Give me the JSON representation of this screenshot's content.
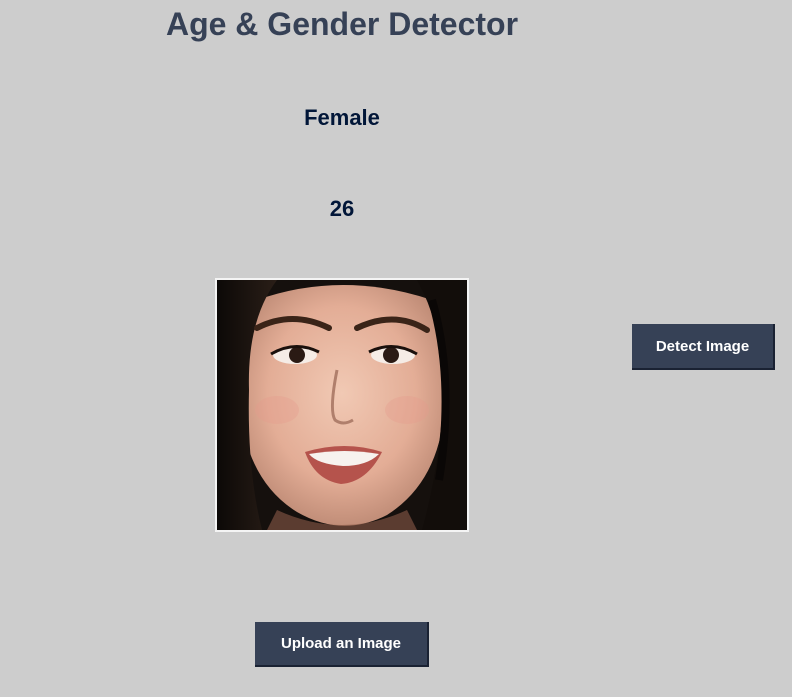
{
  "app": {
    "title": "Age & Gender Detector"
  },
  "result": {
    "gender": "Female",
    "age": "26"
  },
  "image": {
    "description_icon": "face-photo"
  },
  "buttons": {
    "detect_label": "Detect Image",
    "upload_label": "Upload an Image"
  },
  "colors": {
    "background": "#cdcdcd",
    "title": "#364156",
    "result_text": "#011638",
    "button_bg": "#364156",
    "button_text": "#ffffff"
  }
}
